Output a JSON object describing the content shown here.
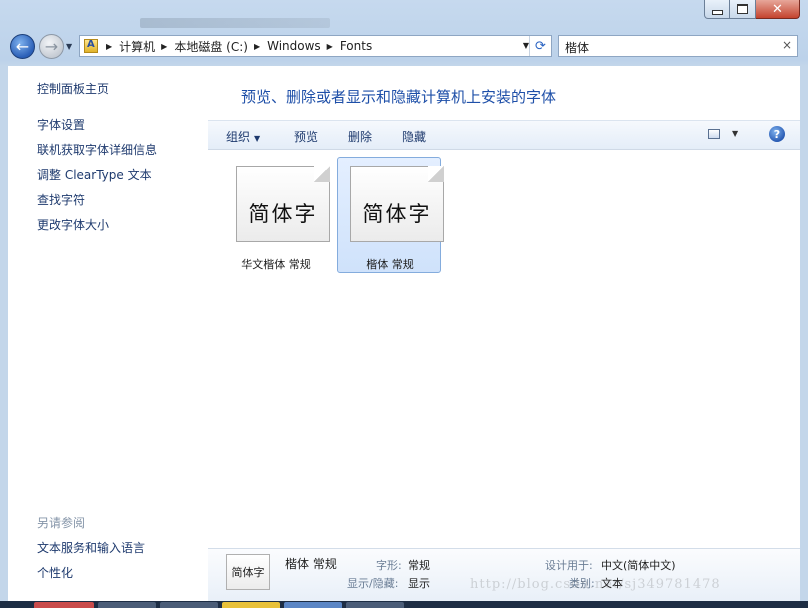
{
  "nav": {
    "back_glyph": "←",
    "forward_glyph": "→",
    "breadcrumbs": [
      "计算机",
      "本地磁盘 (C:)",
      "Windows",
      "Fonts"
    ],
    "refresh_glyph": "⟳",
    "search_value": "楷体",
    "search_clear": "×"
  },
  "sidebar": {
    "home": "控制面板主页",
    "links": [
      "字体设置",
      "联机获取字体详细信息",
      "调整 ClearType 文本",
      "查找字符",
      "更改字体大小"
    ],
    "see_also": "另请参阅",
    "see_also_links": [
      "文本服务和输入语言",
      "个性化"
    ]
  },
  "pane": {
    "title": "预览、删除或者显示和隐藏计算机上安装的字体"
  },
  "toolbar": {
    "organize": "组织",
    "preview": "预览",
    "delete": "删除",
    "hide": "隐藏",
    "help": "?"
  },
  "files": [
    {
      "preview": "简体字",
      "label": "华文楷体 常规",
      "selected": false
    },
    {
      "preview": "简体字",
      "label": "楷体 常规",
      "selected": true
    }
  ],
  "details": {
    "thumb": "简体字",
    "name": "楷体 常规",
    "style_label": "字形:",
    "style_value": "常规",
    "show_label": "显示/隐藏:",
    "show_value": "显示",
    "design_label": "设计用于:",
    "design_value": "中文(简体中文)",
    "category_label": "类别:",
    "category_value": "文本"
  },
  "watermark": "http://blog.csdn.net/sj349781478",
  "colors": {
    "link": "#1e3a6e",
    "title_blue": "#1e4fa8",
    "selection": "#cfe2fb",
    "close_red": "#c4432e"
  }
}
